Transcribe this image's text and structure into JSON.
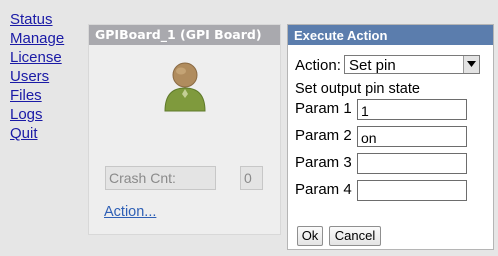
{
  "nav": {
    "items": [
      {
        "label": "Status"
      },
      {
        "label": "Manage"
      },
      {
        "label": "License"
      },
      {
        "label": "Users"
      },
      {
        "label": "Files"
      },
      {
        "label": "Logs"
      },
      {
        "label": "Quit"
      }
    ]
  },
  "board": {
    "title": "GPIBoard_1 (GPI Board)",
    "avatar_icon": "user-avatar-icon",
    "crash_label": "Crash Cnt:",
    "crash_value": "0",
    "action_link": "Action..."
  },
  "dialog": {
    "title": "Execute Action",
    "action_label": "Action:",
    "action_selected": "Set pin",
    "description": "Set output pin state",
    "params": [
      {
        "label": "Param 1",
        "value": "1"
      },
      {
        "label": "Param 2",
        "value": "on"
      },
      {
        "label": "Param 3",
        "value": ""
      },
      {
        "label": "Param 4",
        "value": ""
      }
    ],
    "ok_label": "Ok",
    "cancel_label": "Cancel"
  },
  "colors": {
    "link": "#1a1aa6",
    "panel_header": "#a9a9ae",
    "dialog_header": "#5b7dad",
    "avatar_body": "#7f9a3d",
    "avatar_head": "#b08c5e"
  }
}
